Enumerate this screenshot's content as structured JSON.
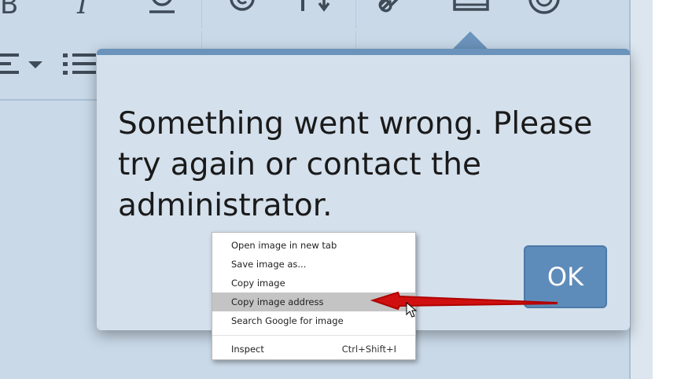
{
  "toolbar": {
    "row1_icons": [
      "bold-icon",
      "italic-icon",
      "underline-icon",
      "copyright-icon",
      "text-direction-icon",
      "link-icon",
      "image-icon",
      "emoji-icon"
    ],
    "row2_icons": [
      "align-dropdown-icon",
      "bulleted-list-icon"
    ]
  },
  "dialog": {
    "message": "Something went wrong. Please try again or contact the administrator.",
    "ok_label": "OK",
    "accent_color": "#6b93bb",
    "button_color": "#5e8cba"
  },
  "context_menu": {
    "items": [
      {
        "label": "Open image in new tab"
      },
      {
        "label": "Save image as..."
      },
      {
        "label": "Copy image"
      },
      {
        "label": "Copy image address",
        "highlighted": true
      },
      {
        "label": "Search Google for image"
      },
      {
        "label": "Inspect",
        "shortcut": "Ctrl+Shift+I"
      }
    ]
  },
  "annotation": {
    "arrow_color": "#d01010",
    "cursor_icon": "mouse-pointer-icon"
  }
}
